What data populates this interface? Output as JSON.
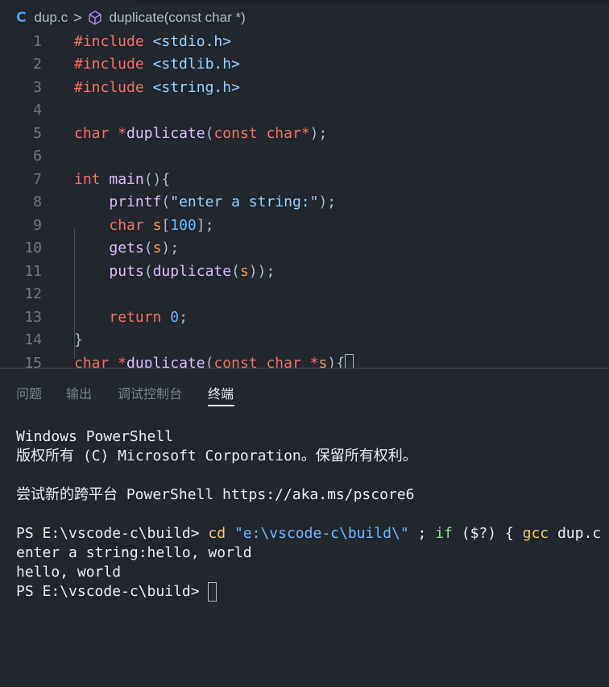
{
  "breadcrumb": {
    "language_icon": "C",
    "file": "dup.c",
    "separator": ">",
    "symbol": "duplicate(const char *)"
  },
  "editor": {
    "line_numbers": [
      "1",
      "2",
      "3",
      "4",
      "5",
      "6",
      "7",
      "8",
      "9",
      "10",
      "11",
      "12",
      "13",
      "14",
      "15"
    ],
    "lines": [
      "#include <stdio.h>",
      "#include <stdlib.h>",
      "#include <string.h>",
      "",
      "char *duplicate(const char*);",
      "",
      "int main(){",
      "    printf(\"enter a string:\");",
      "    char s[100];",
      "    gets(s);",
      "    puts(duplicate(s));",
      "",
      "    return 0;",
      "}",
      "char *duplicate(const char *s){"
    ]
  },
  "panel": {
    "tabs": [
      "问题",
      "输出",
      "调试控制台",
      "终端"
    ],
    "active_tab": "终端"
  },
  "terminal": {
    "line1": "Windows PowerShell",
    "line2": "版权所有 (C) Microsoft Corporation。保留所有权利。",
    "line3": "尝试新的跨平台 PowerShell https://aka.ms/pscore6",
    "prompt1": "PS E:\\vscode-c\\build> ",
    "cmd_cd": "cd",
    "cmd_path": "\"e:\\vscode-c\\build\\\"",
    "cmd_semi": " ; ",
    "cmd_if": "if",
    "cmd_cond": " ($?) { ",
    "cmd_gcc": "gcc",
    "cmd_rest": " dup.c",
    "out1": "enter a string:hello, world",
    "out2": "hello, world",
    "prompt2": "PS E:\\vscode-c\\build> "
  },
  "colors": {
    "background": "#22272e",
    "keyword": "#f47067",
    "string": "#96d0ff",
    "function": "#dcbdfb",
    "number": "#6cb6ff"
  }
}
